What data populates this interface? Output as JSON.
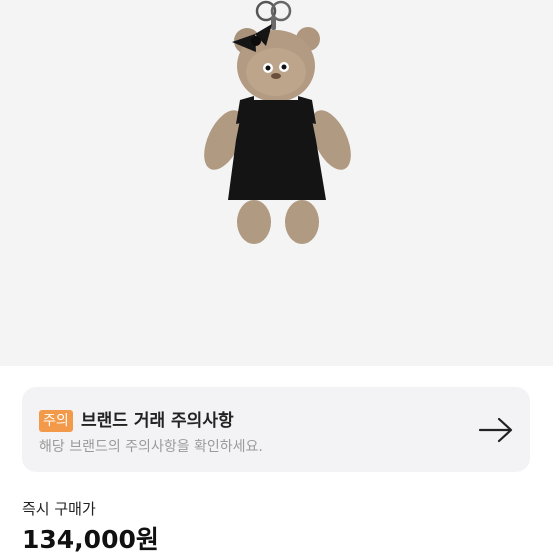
{
  "notice": {
    "badge": "주의",
    "title": "브랜드 거래 주의사항",
    "subtitle": "해당 브랜드의 주의사항을 확인하세요.",
    "arrow_icon": "arrow-right-icon",
    "badge_color": "#f2994a"
  },
  "purchase": {
    "label": "즉시 구매가",
    "price": "134,000원"
  },
  "product_image": {
    "icon": "bear-keyring-image"
  }
}
